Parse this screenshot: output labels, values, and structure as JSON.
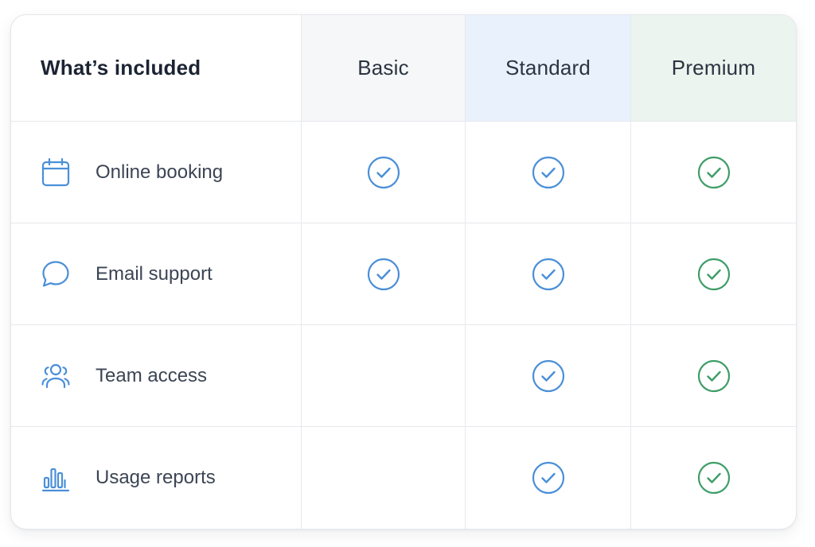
{
  "table": {
    "header": {
      "feature_column": "What’s included",
      "plans": [
        {
          "name": "Basic",
          "bg": "#f6f7f8",
          "check_color": "#4a8fd8"
        },
        {
          "name": "Standard",
          "bg": "#e9f1fd",
          "check_color": "#4a8fd8"
        },
        {
          "name": "Premium",
          "bg": "#ebf4ee",
          "check_color": "#3f9d68"
        }
      ]
    },
    "rows": [
      {
        "label": "Online booking",
        "icon": "calendar-icon",
        "included": [
          true,
          true,
          true
        ]
      },
      {
        "label": "Email support",
        "icon": "chat-bubble-icon",
        "included": [
          true,
          true,
          true
        ]
      },
      {
        "label": "Team access",
        "icon": "users-icon",
        "included": [
          false,
          true,
          true
        ]
      },
      {
        "label": "Usage reports",
        "icon": "bar-chart-icon",
        "included": [
          false,
          true,
          true
        ]
      }
    ],
    "icon_color": "#4a8fd8"
  }
}
